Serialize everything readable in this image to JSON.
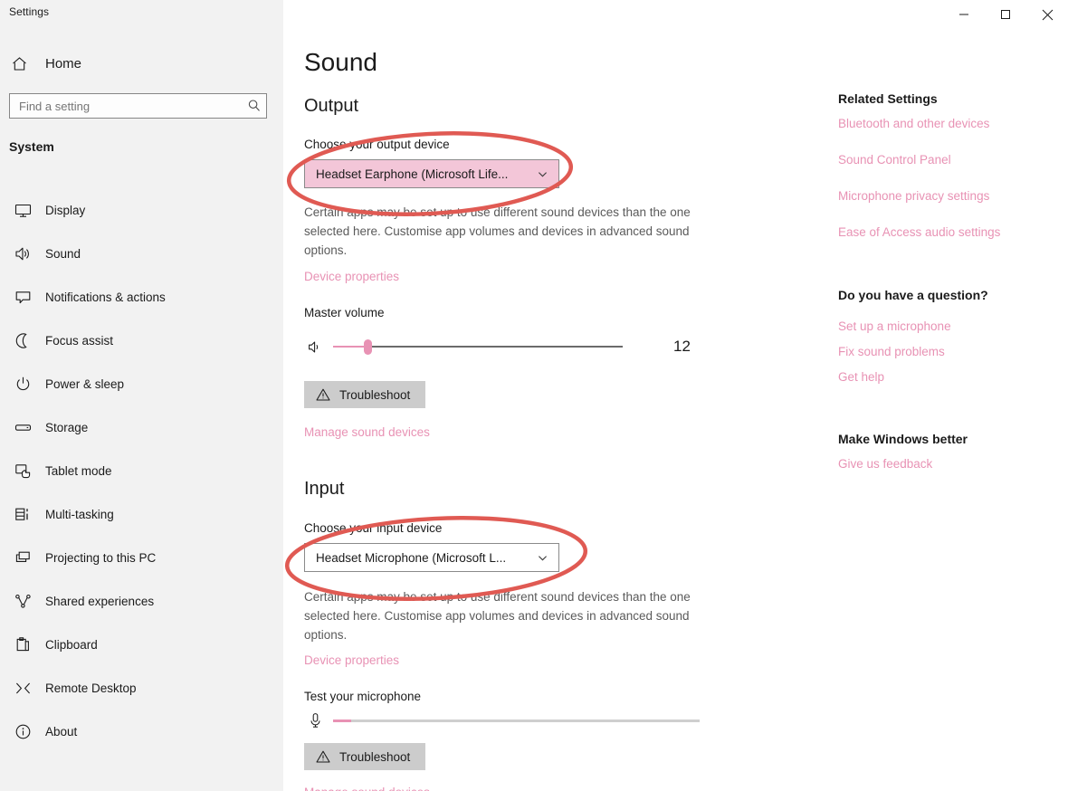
{
  "window": {
    "title": "Settings",
    "controls": {
      "minimize": "minimize-icon",
      "maximize": "maximize-icon",
      "close": "close-icon"
    }
  },
  "sidebar": {
    "home_label": "Home",
    "home_icon": "home-icon",
    "search": {
      "placeholder": "Find a setting",
      "value": "",
      "icon": "search-icon"
    },
    "group_title": "System",
    "items": [
      {
        "label": "Display",
        "icon": "monitor-icon"
      },
      {
        "label": "Sound",
        "icon": "speaker-icon"
      },
      {
        "label": "Notifications & actions",
        "icon": "chat-bubble-icon"
      },
      {
        "label": "Focus assist",
        "icon": "moon-icon"
      },
      {
        "label": "Power & sleep",
        "icon": "power-icon"
      },
      {
        "label": "Storage",
        "icon": "drive-icon"
      },
      {
        "label": "Tablet mode",
        "icon": "tablet-hand-icon"
      },
      {
        "label": "Multi-tasking",
        "icon": "multitask-icon"
      },
      {
        "label": "Projecting to this PC",
        "icon": "project-screen-icon"
      },
      {
        "label": "Shared experiences",
        "icon": "share-nodes-icon"
      },
      {
        "label": "Clipboard",
        "icon": "clipboard-icon"
      },
      {
        "label": "Remote Desktop",
        "icon": "remote-desktop-icon"
      },
      {
        "label": "About",
        "icon": "info-icon"
      }
    ]
  },
  "main": {
    "page_title": "Sound",
    "output": {
      "heading": "Output",
      "choose_label": "Choose your output device",
      "device_value": "Headset Earphone (Microsoft Life...",
      "chevron_icon": "chevron-down-icon",
      "description": "Certain apps may be set up to use different sound devices than the one selected here. Customise app volumes and devices in advanced sound options.",
      "device_properties_link": "Device properties",
      "volume_label": "Master volume",
      "volume_value": "12",
      "volume_percent": 12,
      "speaker_icon": "speaker-volume-icon",
      "troubleshoot_label": "Troubleshoot",
      "warning_icon": "warning-triangle-icon",
      "manage_link": "Manage sound devices"
    },
    "input": {
      "heading": "Input",
      "choose_label": "Choose your input device",
      "device_value": "Headset Microphone (Microsoft L...",
      "chevron_icon": "chevron-down-icon",
      "description": "Certain apps may be set up to use different sound devices than the one selected here. Customise app volumes and devices in advanced sound options.",
      "device_properties_link": "Device properties",
      "test_label": "Test your microphone",
      "test_level_percent": 5,
      "mic_icon": "microphone-icon",
      "troubleshoot_label": "Troubleshoot",
      "warning_icon": "warning-triangle-icon",
      "manage_link": "Manage sound devices"
    }
  },
  "right_panel": {
    "related_settings": {
      "heading": "Related Settings",
      "links": [
        "Bluetooth and other devices",
        "Sound Control Panel",
        "Microphone privacy settings",
        "Ease of Access audio settings"
      ]
    },
    "question": {
      "heading": "Do you have a question?",
      "links": [
        "Set up a microphone",
        "Fix sound problems",
        "Get help"
      ]
    },
    "feedback": {
      "heading": "Make Windows better",
      "links": [
        "Give us feedback"
      ]
    }
  },
  "annotations": {
    "output_ellipse": "red-ellipse-highlight-output-device",
    "input_ellipse": "red-ellipse-highlight-input-device",
    "color": "#e05a53"
  },
  "colors": {
    "accent_pink": "#e892b4",
    "sidebar_bg": "#f2f2f2",
    "highlight_bg": "#f3c6d8",
    "annotation_red": "#e05a53"
  }
}
